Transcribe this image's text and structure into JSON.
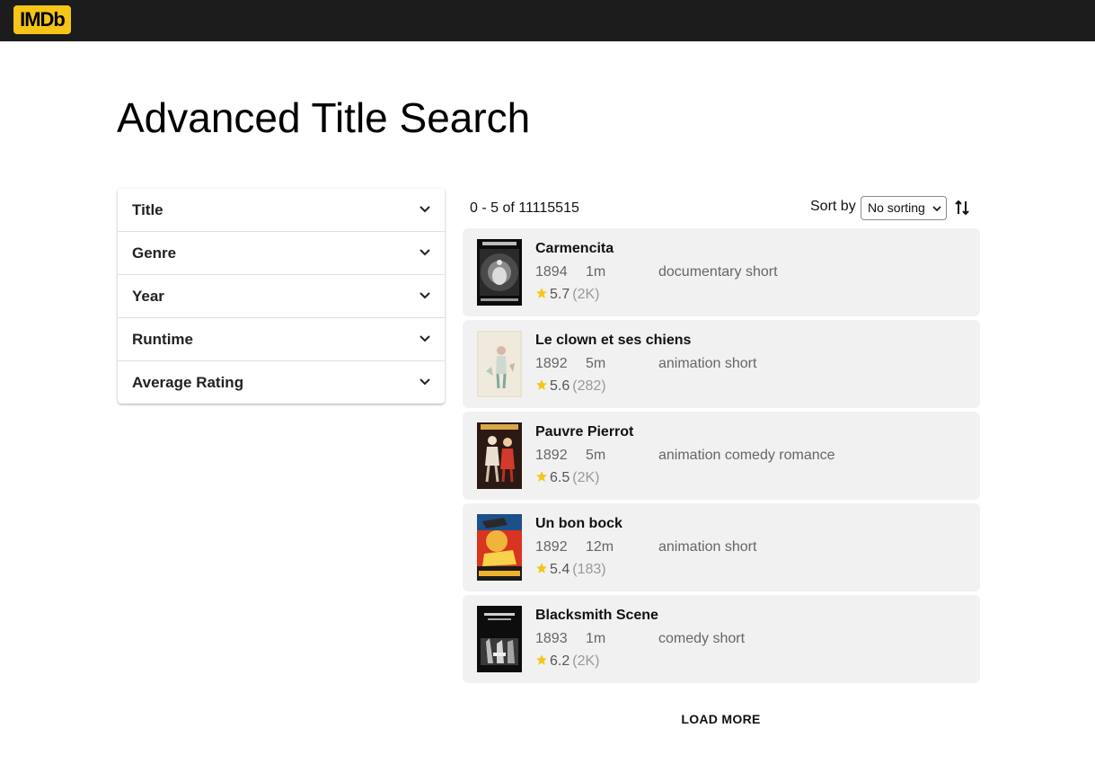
{
  "header": {
    "logo_text": "IMDb",
    "logo_color": "#f5c518",
    "bar_color": "#1c1c1c"
  },
  "page": {
    "title": "Advanced Title Search"
  },
  "filters": [
    {
      "label": "Title",
      "icon": "chevron-down-icon"
    },
    {
      "label": "Genre",
      "icon": "chevron-down-icon"
    },
    {
      "label": "Year",
      "icon": "chevron-down-icon"
    },
    {
      "label": "Runtime",
      "icon": "chevron-down-icon"
    },
    {
      "label": "Average Rating",
      "icon": "chevron-down-icon"
    }
  ],
  "results_header": {
    "count_text": "0 - 5 of 11115515",
    "sort_label": "Sort by",
    "sort_value": "No sorting",
    "sort_toggle_icon": "swap-vertical-icon"
  },
  "results": [
    {
      "title": "Carmencita",
      "year": "1894",
      "runtime": "1m",
      "genres": "documentary short",
      "rating": "5.7",
      "votes": "(2K)",
      "poster": "poster-carmencita"
    },
    {
      "title": "Le clown et ses chiens",
      "year": "1892",
      "runtime": "5m",
      "genres": "animation short",
      "rating": "5.6",
      "votes": "(282)",
      "poster": "poster-le-clown"
    },
    {
      "title": "Pauvre Pierrot",
      "year": "1892",
      "runtime": "5m",
      "genres": "animation comedy romance",
      "rating": "6.5",
      "votes": "(2K)",
      "poster": "poster-pauvre-pierrot"
    },
    {
      "title": "Un bon bock",
      "year": "1892",
      "runtime": "12m",
      "genres": "animation short",
      "rating": "5.4",
      "votes": "(183)",
      "poster": "poster-un-bon-bock"
    },
    {
      "title": "Blacksmith Scene",
      "year": "1893",
      "runtime": "1m",
      "genres": "comedy short",
      "rating": "6.2",
      "votes": "(2K)",
      "poster": "poster-blacksmith-scene"
    }
  ],
  "load_more_label": "LOAD MORE",
  "colors": {
    "star": "#f5c518",
    "card_bg": "#f1f1f1",
    "meta_text": "#666666"
  }
}
